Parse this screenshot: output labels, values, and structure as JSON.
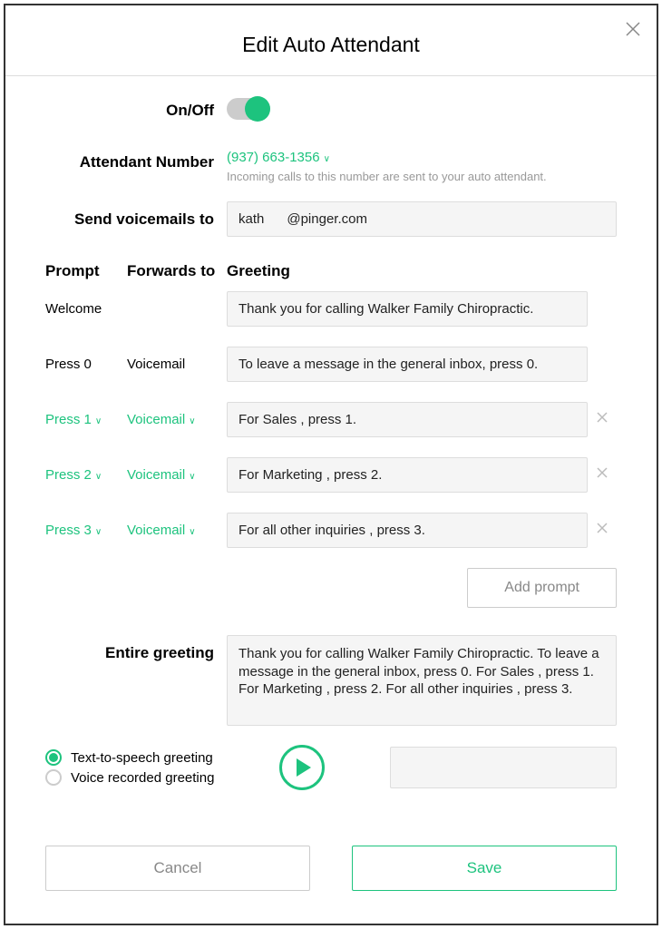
{
  "title": "Edit Auto Attendant",
  "onoff_label": "On/Off",
  "attendant_label": "Attendant Number",
  "attendant_number": "(937) 663-1356",
  "attendant_helper": "Incoming calls to this number are sent to your auto attendant.",
  "voicemail_label": "Send voicemails to",
  "voicemail_value": "kath      @pinger.com",
  "headers": {
    "prompt": "Prompt",
    "forwards": "Forwards to",
    "greeting": "Greeting"
  },
  "rows": [
    {
      "prompt": "Welcome",
      "forwards": "",
      "greeting": "Thank you for calling Walker Family Chiropractic.",
      "editable": false,
      "deletable": false
    },
    {
      "prompt": "Press 0",
      "forwards": "Voicemail",
      "greeting": "To leave a message in the general inbox, press 0.",
      "editable": false,
      "deletable": false
    },
    {
      "prompt": "Press 1",
      "forwards": "Voicemail",
      "greeting": "For Sales , press 1.",
      "editable": true,
      "deletable": true
    },
    {
      "prompt": "Press 2",
      "forwards": "Voicemail",
      "greeting": "For Marketing , press 2.",
      "editable": true,
      "deletable": true
    },
    {
      "prompt": "Press 3",
      "forwards": "Voicemail",
      "greeting": "For all other inquiries , press 3.",
      "editable": true,
      "deletable": true
    }
  ],
  "add_prompt": "Add prompt",
  "entire_label": "Entire greeting",
  "entire_value": "Thank you for calling Walker Family Chiropractic. To leave a message in the general inbox, press 0. For Sales , press 1. For Marketing , press 2. For all other inquiries , press 3.",
  "greeting_options": {
    "tts": "Text-to-speech greeting",
    "voice": "Voice recorded greeting"
  },
  "buttons": {
    "cancel": "Cancel",
    "save": "Save"
  }
}
